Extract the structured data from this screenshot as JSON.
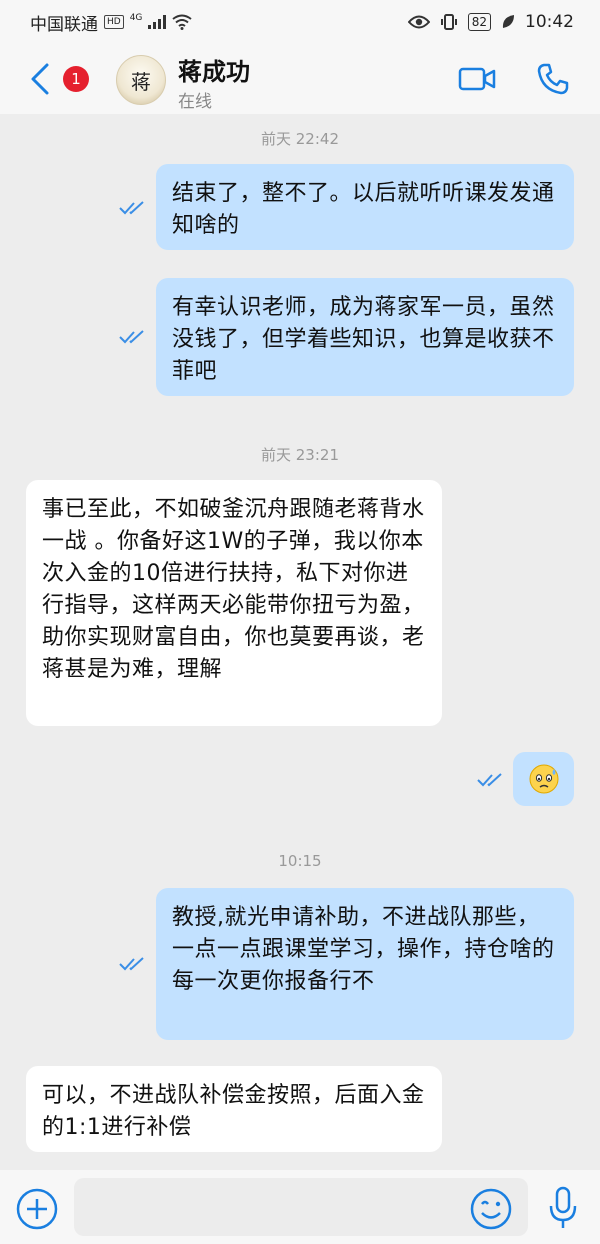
{
  "status_bar": {
    "carrier": "中国联通",
    "hd": "HD",
    "network": "4G",
    "battery": "82",
    "time": "10:42"
  },
  "header": {
    "unread_count": "1",
    "avatar_text": "蒋",
    "contact_name": "蒋成功",
    "contact_status": "在线",
    "icons": [
      "back-icon",
      "video-call-icon",
      "phone-icon"
    ]
  },
  "messages": {
    "t1": "前天 22:42",
    "m1": "结束了，整不了。以后就听听课发发通知啥的",
    "m2": "有幸认识老师，成为蒋家军一员，虽然没钱了，但学着些知识，也算是收获不菲吧",
    "t2": "前天 23:21",
    "m3": "事已至此，不如破釜沉舟跟随老蒋背水一战 。你备好这1W的子弹，我以你本次入金的10倍进行扶持，私下对你进行指导，这样两天必能带你扭亏为盈，助你实现财富自由，你也莫要再谈，老蒋甚是为难，理解",
    "m4_emoji": "😥",
    "t3": "10:15",
    "m5": "教授,就光申请补助，不进战队那些，一点一点跟课堂学习，操作，持仓啥的每一次更你报备行不",
    "m6": "可以，不进战队补偿金按照，后面入金的1:1进行补偿"
  },
  "colors": {
    "outgoing_bubble": "#c2e1ff",
    "incoming_bubble": "#ffffff",
    "accent": "#1a7fe0",
    "badge": "#e5202e"
  },
  "bottom_bar": {
    "icons": [
      "plus-icon",
      "emoji-icon",
      "microphone-icon"
    ]
  }
}
